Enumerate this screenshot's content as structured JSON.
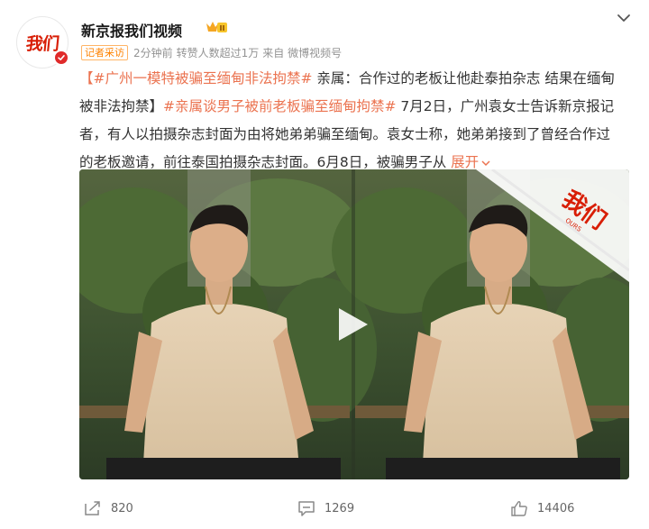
{
  "header": {
    "avatar_text": "我们",
    "username": "新京报我们视频",
    "vip_level": "II",
    "tag": "记者采访",
    "time": "2分钟前",
    "reposted": "转赞人数超过1万",
    "source": "来自 微博视频号"
  },
  "post": {
    "line1_topic": "【#广州一模特被骗至缅甸非法拘禁#",
    "line1_rest": " 亲属：合作过的老板让他赴泰拍杂志 结果在缅甸",
    "line2_start": "被非法拘禁】",
    "line2_topic": "#亲属谈男子被前老板骗至缅甸拘禁#",
    "line2_rest": " 7月2日，广州袁女士告诉新京报记",
    "line3": "者，有人以拍摄杂志封面为由将她弟弟骗至缅甸。袁女士称，她弟弟接到了曾经合作过",
    "line4": "的老板邀请，前往泰国拍摄杂志封面。6月8日，被骗男子从",
    "expand_label": "展开",
    "video_watermark": "我们",
    "video_watermark_sub": "OURS"
  },
  "actions": {
    "repost_count": "820",
    "comment_count": "1269",
    "like_count": "14406"
  },
  "colors": {
    "link": "#eb7350",
    "brand_red": "#d81e06",
    "tag_orange": "#ff8200"
  }
}
